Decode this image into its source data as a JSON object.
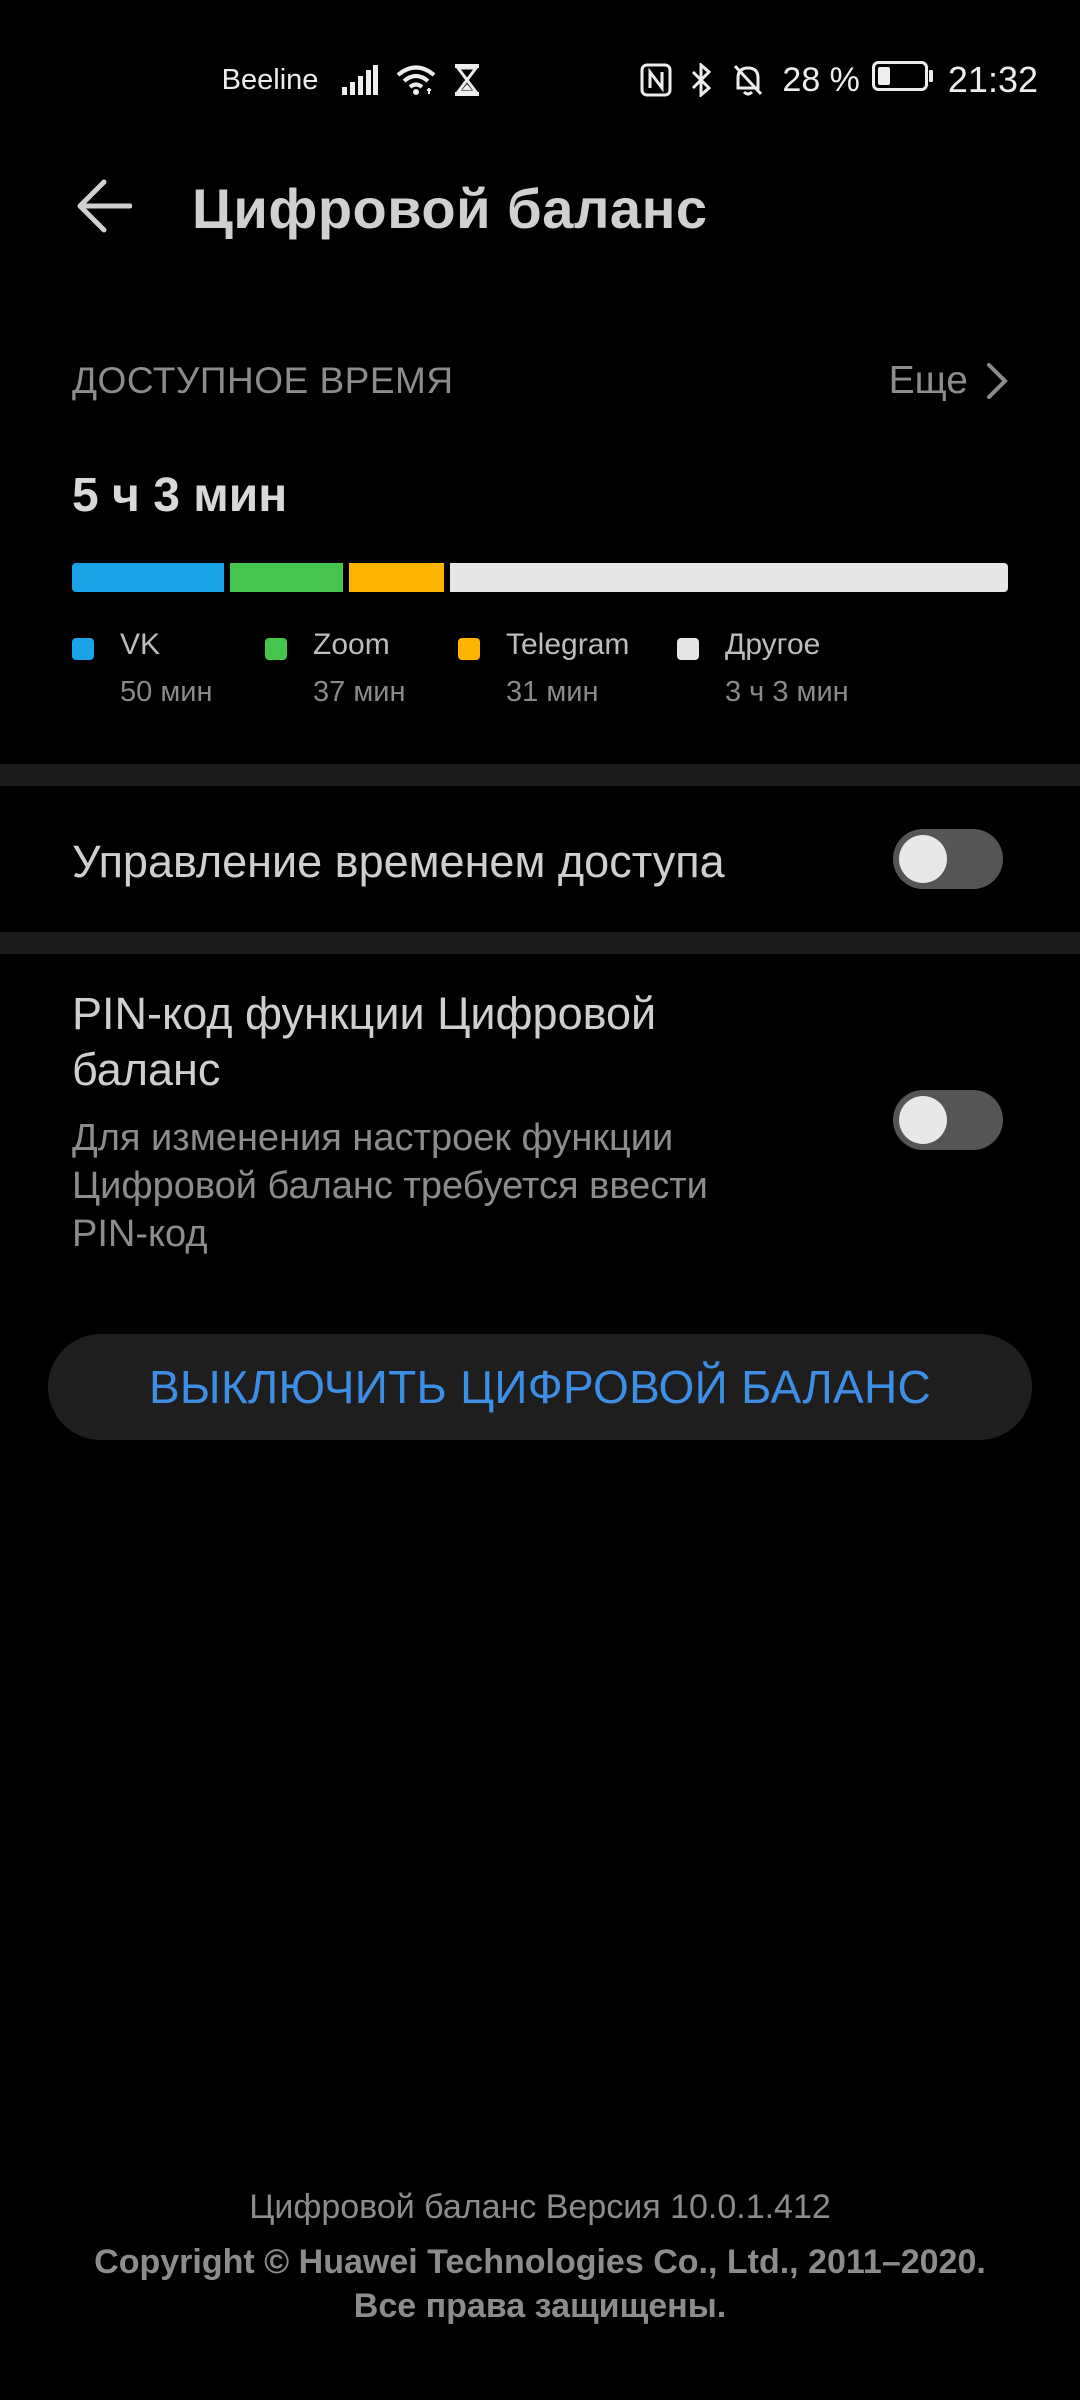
{
  "status_bar": {
    "carrier": "Beeline",
    "battery_percent": "28 %",
    "battery_level": 0.28,
    "time": "21:32",
    "icons": [
      "signal-icon",
      "wifi-icon",
      "hourglass-icon",
      "nfc-icon",
      "bluetooth-icon",
      "mute-icon",
      "battery-icon"
    ]
  },
  "header": {
    "title": "Цифровой баланс",
    "back_icon": "back-arrow-icon"
  },
  "available_time": {
    "label": "ДОСТУПНОЕ ВРЕМЯ",
    "more_label": "Еще",
    "total": "5 ч 3 мин",
    "apps": [
      {
        "name": "VK",
        "time": "50 мин",
        "minutes": 50,
        "color": "#1aa3e8"
      },
      {
        "name": "Zoom",
        "time": "37 мин",
        "minutes": 37,
        "color": "#46c54c"
      },
      {
        "name": "Telegram",
        "time": "31 мин",
        "minutes": 31,
        "color": "#ffb400"
      },
      {
        "name": "Другое",
        "time": "3 ч 3 мин",
        "minutes": 183,
        "color": "#e6e6e6"
      }
    ]
  },
  "access_time_control": {
    "label": "Управление временем доступа",
    "enabled": false
  },
  "pin_code": {
    "title_line1": "PIN-код функции Цифровой",
    "title_line2": "баланс",
    "desc_line1": "Для изменения настроек функции",
    "desc_line2": "Цифровой баланс требуется ввести",
    "desc_line3": "PIN-код",
    "enabled": false
  },
  "disable_button": {
    "label": "ВЫКЛЮЧИТЬ ЦИФРОВОЙ БАЛАНС"
  },
  "footer": {
    "version": "Цифровой баланс Версия 10.0.1.412",
    "copyright_line1": "Copyright © Huawei Technologies Co., Ltd., 2011–2020.",
    "copyright_line2": "Все права защищены."
  },
  "colors": {
    "background": "#000000",
    "accent": "#3d8fe6",
    "divider": "#1b1b1b"
  }
}
